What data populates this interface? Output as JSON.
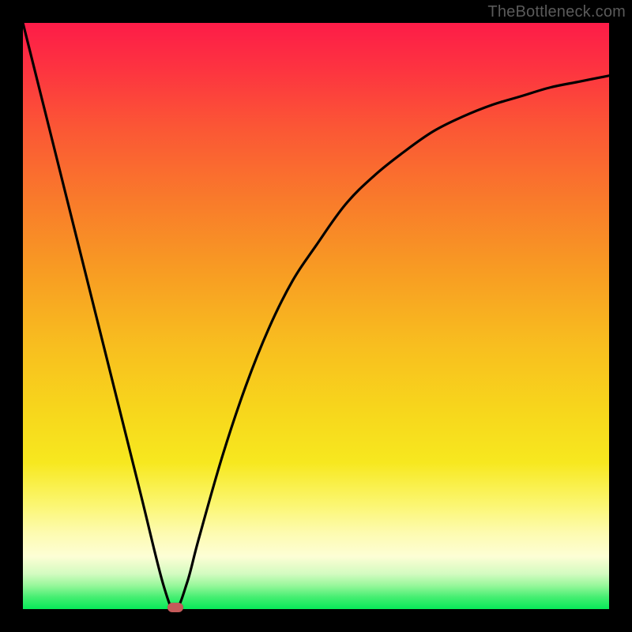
{
  "watermark": "TheBottleneck.com",
  "chart_data": {
    "type": "line",
    "title": "",
    "xlabel": "",
    "ylabel": "",
    "xlim": [
      0,
      100
    ],
    "ylim": [
      0,
      100
    ],
    "grid": false,
    "series": [
      {
        "name": "curve",
        "x": [
          0,
          5,
          10,
          15,
          20,
          24,
          26,
          28,
          30,
          34,
          38,
          42,
          46,
          50,
          55,
          60,
          65,
          70,
          75,
          80,
          85,
          90,
          95,
          100
        ],
        "y": [
          100,
          80,
          60,
          40,
          20,
          4,
          0,
          4.5,
          12,
          26,
          38,
          48,
          56,
          62,
          69,
          74,
          78,
          81.5,
          84,
          86,
          87.5,
          89,
          90,
          91
        ]
      }
    ],
    "annotations": [
      {
        "name": "minimum-marker",
        "x": 26,
        "y": 0,
        "color": "#c55a5a"
      }
    ],
    "background_gradient": {
      "direction": "vertical",
      "stops": [
        {
          "pos": 0.0,
          "color": "#fd1c48"
        },
        {
          "pos": 0.5,
          "color": "#f8c01f"
        },
        {
          "pos": 0.85,
          "color": "#fdfcc0"
        },
        {
          "pos": 1.0,
          "color": "#07e958"
        }
      ]
    }
  }
}
